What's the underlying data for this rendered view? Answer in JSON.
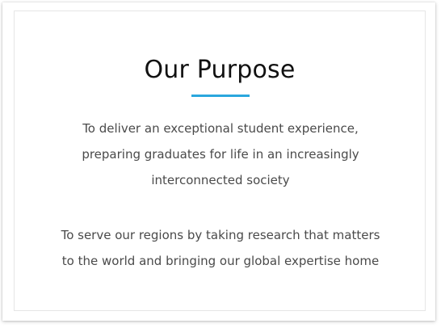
{
  "heading": "Our Purpose",
  "accent_color": "#2aa7dd",
  "paragraphs": [
    {
      "lines": [
        "To deliver an exceptional student experience,",
        "preparing graduates for life in an increasingly",
        "interconnected society"
      ]
    },
    {
      "lines": [
        "To serve our regions by taking research that matters",
        "to the world and bringing our global expertise home"
      ]
    }
  ]
}
